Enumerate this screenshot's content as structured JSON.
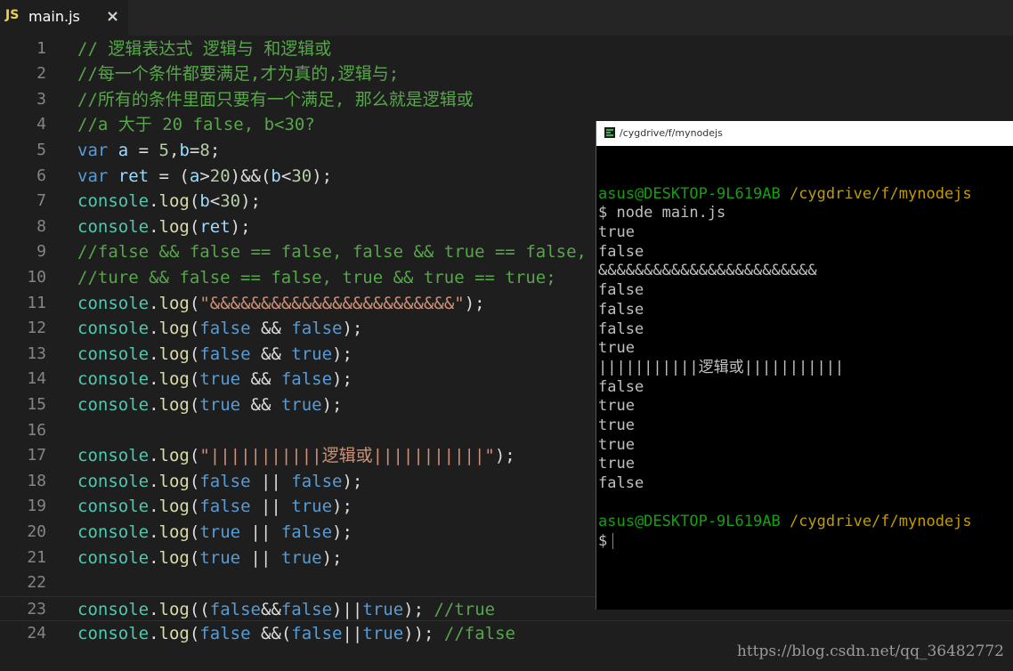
{
  "tab": {
    "icon_label": "JS",
    "title": "main.js",
    "close_label": "×"
  },
  "editor": {
    "lines": [
      {
        "n": "1",
        "tokens": [
          {
            "c": "t-comment",
            "t": "// 逻辑表达式 逻辑与 和逻辑或"
          }
        ]
      },
      {
        "n": "2",
        "tokens": [
          {
            "c": "t-comment",
            "t": "//每一个条件都要满足,才为真的,逻辑与;"
          }
        ]
      },
      {
        "n": "3",
        "tokens": [
          {
            "c": "t-comment",
            "t": "//所有的条件里面只要有一个满足, 那么就是逻辑或"
          }
        ]
      },
      {
        "n": "4",
        "tokens": [
          {
            "c": "t-comment",
            "t": "//a 大于 20 false, b<30?"
          }
        ]
      },
      {
        "n": "5",
        "tokens": [
          {
            "c": "t-keyword",
            "t": "var "
          },
          {
            "c": "t-var",
            "t": "a"
          },
          {
            "c": "t-punc",
            "t": " = "
          },
          {
            "c": "t-num",
            "t": "5"
          },
          {
            "c": "t-punc",
            "t": ","
          },
          {
            "c": "t-var",
            "t": "b"
          },
          {
            "c": "t-punc",
            "t": "="
          },
          {
            "c": "t-num",
            "t": "8"
          },
          {
            "c": "t-punc",
            "t": ";"
          }
        ]
      },
      {
        "n": "6",
        "tokens": [
          {
            "c": "t-keyword",
            "t": "var "
          },
          {
            "c": "t-var",
            "t": "ret"
          },
          {
            "c": "t-punc",
            "t": " = ("
          },
          {
            "c": "t-var",
            "t": "a"
          },
          {
            "c": "t-punc",
            "t": ">"
          },
          {
            "c": "t-num",
            "t": "20"
          },
          {
            "c": "t-punc",
            "t": ")&&("
          },
          {
            "c": "t-var",
            "t": "b"
          },
          {
            "c": "t-punc",
            "t": "<"
          },
          {
            "c": "t-num",
            "t": "30"
          },
          {
            "c": "t-punc",
            "t": ");"
          }
        ]
      },
      {
        "n": "7",
        "tokens": [
          {
            "c": "t-func",
            "t": "console"
          },
          {
            "c": "t-punc",
            "t": "."
          },
          {
            "c": "t-method",
            "t": "log"
          },
          {
            "c": "t-punc",
            "t": "("
          },
          {
            "c": "t-var",
            "t": "b"
          },
          {
            "c": "t-punc",
            "t": "<"
          },
          {
            "c": "t-num",
            "t": "30"
          },
          {
            "c": "t-punc",
            "t": ");"
          }
        ]
      },
      {
        "n": "8",
        "tokens": [
          {
            "c": "t-func",
            "t": "console"
          },
          {
            "c": "t-punc",
            "t": "."
          },
          {
            "c": "t-method",
            "t": "log"
          },
          {
            "c": "t-punc",
            "t": "("
          },
          {
            "c": "t-var",
            "t": "ret"
          },
          {
            "c": "t-punc",
            "t": ");"
          }
        ]
      },
      {
        "n": "9",
        "tokens": [
          {
            "c": "t-comment",
            "t": "//false && false == false, false && true == false,"
          }
        ]
      },
      {
        "n": "10",
        "tokens": [
          {
            "c": "t-comment",
            "t": "//ture && false == false, true && true == true;"
          }
        ]
      },
      {
        "n": "11",
        "tokens": [
          {
            "c": "t-func",
            "t": "console"
          },
          {
            "c": "t-punc",
            "t": "."
          },
          {
            "c": "t-method",
            "t": "log"
          },
          {
            "c": "t-punc",
            "t": "("
          },
          {
            "c": "t-str",
            "t": "\"&&&&&&&&&&&&&&&&&&&&&&&&\""
          },
          {
            "c": "t-punc",
            "t": ");"
          }
        ]
      },
      {
        "n": "12",
        "tokens": [
          {
            "c": "t-func",
            "t": "console"
          },
          {
            "c": "t-punc",
            "t": "."
          },
          {
            "c": "t-method",
            "t": "log"
          },
          {
            "c": "t-punc",
            "t": "("
          },
          {
            "c": "t-keyword",
            "t": "false"
          },
          {
            "c": "t-punc",
            "t": " && "
          },
          {
            "c": "t-keyword",
            "t": "false"
          },
          {
            "c": "t-punc",
            "t": ");"
          }
        ]
      },
      {
        "n": "13",
        "tokens": [
          {
            "c": "t-func",
            "t": "console"
          },
          {
            "c": "t-punc",
            "t": "."
          },
          {
            "c": "t-method",
            "t": "log"
          },
          {
            "c": "t-punc",
            "t": "("
          },
          {
            "c": "t-keyword",
            "t": "false"
          },
          {
            "c": "t-punc",
            "t": " && "
          },
          {
            "c": "t-keyword",
            "t": "true"
          },
          {
            "c": "t-punc",
            "t": ");"
          }
        ]
      },
      {
        "n": "14",
        "tokens": [
          {
            "c": "t-func",
            "t": "console"
          },
          {
            "c": "t-punc",
            "t": "."
          },
          {
            "c": "t-method",
            "t": "log"
          },
          {
            "c": "t-punc",
            "t": "("
          },
          {
            "c": "t-keyword",
            "t": "true"
          },
          {
            "c": "t-punc",
            "t": " && "
          },
          {
            "c": "t-keyword",
            "t": "false"
          },
          {
            "c": "t-punc",
            "t": ");"
          }
        ]
      },
      {
        "n": "15",
        "tokens": [
          {
            "c": "t-func",
            "t": "console"
          },
          {
            "c": "t-punc",
            "t": "."
          },
          {
            "c": "t-method",
            "t": "log"
          },
          {
            "c": "t-punc",
            "t": "("
          },
          {
            "c": "t-keyword",
            "t": "true"
          },
          {
            "c": "t-punc",
            "t": " && "
          },
          {
            "c": "t-keyword",
            "t": "true"
          },
          {
            "c": "t-punc",
            "t": ");"
          }
        ]
      },
      {
        "n": "16",
        "tokens": []
      },
      {
        "n": "17",
        "tokens": [
          {
            "c": "t-func",
            "t": "console"
          },
          {
            "c": "t-punc",
            "t": "."
          },
          {
            "c": "t-method",
            "t": "log"
          },
          {
            "c": "t-punc",
            "t": "("
          },
          {
            "c": "t-str",
            "t": "\"|||||||||||逻辑或|||||||||||\""
          },
          {
            "c": "t-punc",
            "t": ");"
          }
        ]
      },
      {
        "n": "18",
        "tokens": [
          {
            "c": "t-func",
            "t": "console"
          },
          {
            "c": "t-punc",
            "t": "."
          },
          {
            "c": "t-method",
            "t": "log"
          },
          {
            "c": "t-punc",
            "t": "("
          },
          {
            "c": "t-keyword",
            "t": "false"
          },
          {
            "c": "t-punc",
            "t": " || "
          },
          {
            "c": "t-keyword",
            "t": "false"
          },
          {
            "c": "t-punc",
            "t": ");"
          }
        ]
      },
      {
        "n": "19",
        "tokens": [
          {
            "c": "t-func",
            "t": "console"
          },
          {
            "c": "t-punc",
            "t": "."
          },
          {
            "c": "t-method",
            "t": "log"
          },
          {
            "c": "t-punc",
            "t": "("
          },
          {
            "c": "t-keyword",
            "t": "false"
          },
          {
            "c": "t-punc",
            "t": " || "
          },
          {
            "c": "t-keyword",
            "t": "true"
          },
          {
            "c": "t-punc",
            "t": ");"
          }
        ]
      },
      {
        "n": "20",
        "tokens": [
          {
            "c": "t-func",
            "t": "console"
          },
          {
            "c": "t-punc",
            "t": "."
          },
          {
            "c": "t-method",
            "t": "log"
          },
          {
            "c": "t-punc",
            "t": "("
          },
          {
            "c": "t-keyword",
            "t": "true"
          },
          {
            "c": "t-punc",
            "t": " || "
          },
          {
            "c": "t-keyword",
            "t": "false"
          },
          {
            "c": "t-punc",
            "t": ");"
          }
        ]
      },
      {
        "n": "21",
        "tokens": [
          {
            "c": "t-func",
            "t": "console"
          },
          {
            "c": "t-punc",
            "t": "."
          },
          {
            "c": "t-method",
            "t": "log"
          },
          {
            "c": "t-punc",
            "t": "("
          },
          {
            "c": "t-keyword",
            "t": "true"
          },
          {
            "c": "t-punc",
            "t": " || "
          },
          {
            "c": "t-keyword",
            "t": "true"
          },
          {
            "c": "t-punc",
            "t": ");"
          }
        ]
      },
      {
        "n": "22",
        "tokens": []
      },
      {
        "n": "23",
        "current": true,
        "tokens": [
          {
            "c": "t-func",
            "t": "console"
          },
          {
            "c": "t-punc",
            "t": "."
          },
          {
            "c": "t-method",
            "t": "log"
          },
          {
            "c": "t-punc",
            "t": "(("
          },
          {
            "c": "t-keyword",
            "t": "false"
          },
          {
            "c": "t-punc",
            "t": "&&"
          },
          {
            "c": "t-keyword",
            "t": "false"
          },
          {
            "c": "t-punc",
            "t": ")||"
          },
          {
            "c": "t-keyword",
            "t": "true"
          },
          {
            "c": "t-punc",
            "t": "); "
          },
          {
            "c": "t-comment",
            "t": "//true"
          }
        ]
      },
      {
        "n": "24",
        "tokens": [
          {
            "c": "t-func",
            "t": "console"
          },
          {
            "c": "t-punc",
            "t": "."
          },
          {
            "c": "t-method",
            "t": "log"
          },
          {
            "c": "t-punc",
            "t": "("
          },
          {
            "c": "t-keyword",
            "t": "false"
          },
          {
            "c": "t-punc",
            "t": " &&("
          },
          {
            "c": "t-keyword",
            "t": "false"
          },
          {
            "c": "t-punc",
            "t": "||"
          },
          {
            "c": "t-keyword",
            "t": "true"
          },
          {
            "c": "t-punc",
            "t": ")); "
          },
          {
            "c": "t-comment",
            "t": "//false"
          }
        ]
      }
    ]
  },
  "terminal": {
    "title": "/cygdrive/f/mynodejs",
    "prompt_user": "asus@DESKTOP-9L619AB",
    "prompt_path": "/cygdrive/f/mynodejs",
    "lines": [
      {
        "kind": "blank",
        "text": ""
      },
      {
        "kind": "prompt",
        "text": ""
      },
      {
        "kind": "out",
        "text": "$ node main.js"
      },
      {
        "kind": "out",
        "text": "true"
      },
      {
        "kind": "out",
        "text": "false"
      },
      {
        "kind": "out",
        "text": "&&&&&&&&&&&&&&&&&&&&&&&&"
      },
      {
        "kind": "out",
        "text": "false"
      },
      {
        "kind": "out",
        "text": "false"
      },
      {
        "kind": "out",
        "text": "false"
      },
      {
        "kind": "out",
        "text": "true"
      },
      {
        "kind": "out",
        "text": "|||||||||||逻辑或|||||||||||"
      },
      {
        "kind": "out",
        "text": "false"
      },
      {
        "kind": "out",
        "text": "true"
      },
      {
        "kind": "out",
        "text": "true"
      },
      {
        "kind": "out",
        "text": "true"
      },
      {
        "kind": "out",
        "text": "true"
      },
      {
        "kind": "out",
        "text": "false"
      },
      {
        "kind": "blank",
        "text": ""
      },
      {
        "kind": "prompt",
        "text": ""
      },
      {
        "kind": "cursor",
        "text": "$"
      }
    ]
  },
  "watermark": "https://blog.csdn.net/qq_36482772",
  "colors": {
    "editor_bg": "#1e1e1e",
    "comment": "#57a64a",
    "keyword": "#569cd6",
    "function": "#4ec9b0",
    "string": "#ce9178",
    "terminal_bg": "#000000",
    "prompt_user": "#13a10e",
    "prompt_path": "#c19c00"
  }
}
